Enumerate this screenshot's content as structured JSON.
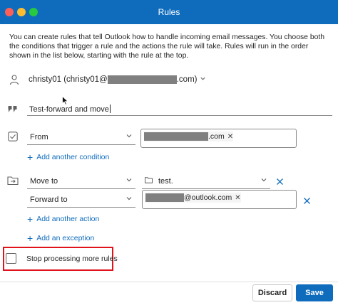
{
  "window": {
    "title": "Rules",
    "controls": [
      "close",
      "minimize",
      "maximize"
    ]
  },
  "intro_text": "You can create rules that tell Outlook how to handle incoming email messages. You choose both the conditions that trigger a rule and the actions the rule will take. Rules will run in the order shown in the list below, starting with the rule at the top.",
  "account": {
    "prefix": "christy01 (christy01@",
    "suffix": ".com)",
    "icon": "person-icon"
  },
  "rule_name": {
    "value": "Test-forward and move",
    "icon": "quote-icon"
  },
  "conditions": {
    "icon": "checkbox-icon",
    "items": [
      {
        "type_label": "From",
        "tag_suffix": ".com"
      }
    ],
    "add_label": "Add another condition"
  },
  "actions": {
    "icon": "folder-move-icon",
    "items": [
      {
        "type_label": "Move to",
        "value": "test."
      },
      {
        "type_label": "Forward to",
        "tag_suffix": "@outlook.com"
      }
    ],
    "add_label": "Add another action"
  },
  "exception": {
    "add_label": "Add an exception"
  },
  "stop_processing": {
    "label": "Stop processing more rules",
    "checked": false
  },
  "buttons": {
    "discard": "Discard",
    "save": "Save"
  },
  "colors": {
    "accent": "#0f6cbd",
    "highlight_box": "#e0131a",
    "redaction": "#808080"
  }
}
